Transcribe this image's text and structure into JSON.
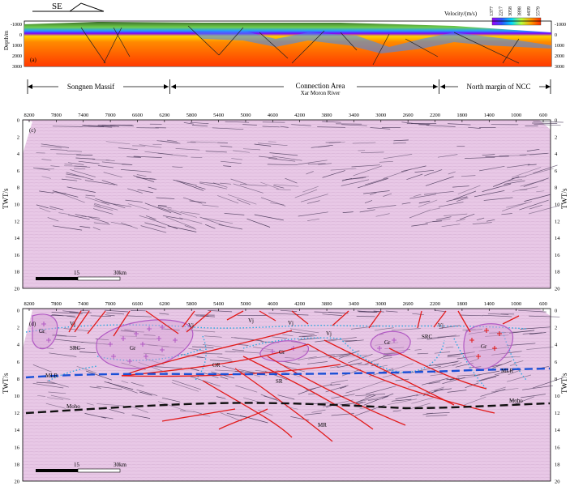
{
  "top": {
    "direction_label": "SE",
    "panel_letter": "(a)",
    "y_axis_label": "Depth/m",
    "left_ticks": [
      "-1000",
      "0",
      "1000",
      "2000",
      "3000"
    ],
    "right_ticks": [
      "-1000",
      "0",
      "1000",
      "2000",
      "3000"
    ],
    "velocity_label": "Velocity/(m/s)",
    "velocity_values": [
      "1377",
      "2217",
      "3058",
      "3898",
      "4439",
      "5579"
    ],
    "velocity_colors": [
      "#9b00ff",
      "#2c54ff",
      "#00d9ff",
      "#b8ff3a",
      "#ff9a00",
      "#ff2a00"
    ]
  },
  "regions": [
    {
      "label": "Songnen Massif"
    },
    {
      "label": "Connection Area",
      "sublabel": "Xar Moron River"
    },
    {
      "label": "North margin of NCC"
    }
  ],
  "panel_c": {
    "letter": "(c)",
    "x_ticks": [
      "8200",
      "7800",
      "7400",
      "7000",
      "6600",
      "6200",
      "5800",
      "5400",
      "5000",
      "4600",
      "4200",
      "3800",
      "3400",
      "3000",
      "2600",
      "2200",
      "1800",
      "1400",
      "1000",
      "600"
    ],
    "y_ticks": [
      "0",
      "2",
      "4",
      "6",
      "8",
      "10",
      "12",
      "14",
      "16",
      "18",
      "20"
    ],
    "y_axis_label": "TWT/s",
    "scale_labels": [
      "15",
      "30km"
    ]
  },
  "panel_d": {
    "letter": "(d)",
    "x_ticks": [
      "8200",
      "7800",
      "7400",
      "7000",
      "6600",
      "6200",
      "5800",
      "5400",
      "5000",
      "4600",
      "4200",
      "3800",
      "3400",
      "3000",
      "2600",
      "2200",
      "1800",
      "1400",
      "1000",
      "600"
    ],
    "y_ticks": [
      "0",
      "2",
      "4",
      "6",
      "8",
      "10",
      "12",
      "14",
      "16",
      "18",
      "20"
    ],
    "y_axis_label": "TWT/s",
    "scale_labels": [
      "15",
      "30km"
    ],
    "labels": {
      "gr1": "Gr",
      "gr2": "Gr",
      "gr3": "Gr",
      "gr4": "Gr",
      "gr5": "Gr",
      "vj1": "Vj",
      "vj2": "Vj",
      "vj3": "Vj",
      "vj4": "Vj",
      "vj5": "Vj",
      "vj6": "Vj",
      "src1": "SRC",
      "src2": "SRC",
      "or": "OR",
      "sr": "SR",
      "mr": "MR",
      "mlr1": "MLR",
      "mlr2": "MLR",
      "moho1": "Moho",
      "moho2": "Moho"
    }
  }
}
